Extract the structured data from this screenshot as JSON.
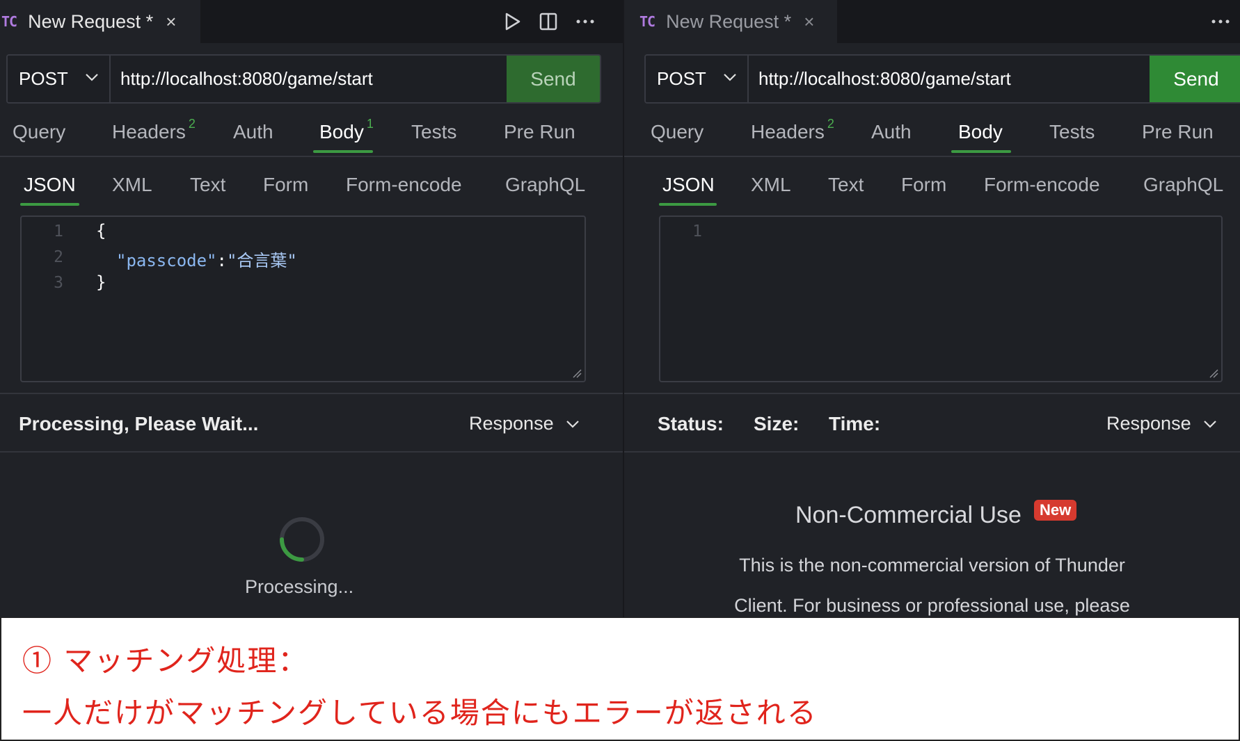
{
  "left": {
    "tab": {
      "logo": "TC",
      "title": "New Request *",
      "close": "×"
    },
    "tab_icons": [
      "play-icon",
      "split-icon",
      "more-icon"
    ],
    "method": "POST",
    "url": "http://localhost:8080/game/start",
    "send": "Send",
    "send_color": "#2e6b2f",
    "sections": {
      "query": "Query",
      "headers": "Headers",
      "headers_count": "2",
      "auth": "Auth",
      "body": "Body",
      "body_count": "1",
      "tests": "Tests",
      "prerun": "Pre Run"
    },
    "body_types": [
      "JSON",
      "XML",
      "Text",
      "Form",
      "Form-encode",
      "GraphQL"
    ],
    "editor": {
      "line_numbers": [
        "1",
        "2",
        "3"
      ],
      "line1": "{",
      "key": "\"passcode\"",
      "colon": ":",
      "value": "\"合言葉\"",
      "line3": "}"
    },
    "status_text": "Processing, Please Wait...",
    "response_label": "Response",
    "processing": "Processing..."
  },
  "right": {
    "tab": {
      "logo": "TC",
      "title": "New Request *",
      "close": "×"
    },
    "method": "POST",
    "url": "http://localhost:8080/game/start",
    "send": "Send",
    "send_color": "#2f8a35",
    "sections": {
      "query": "Query",
      "headers": "Headers",
      "headers_count": "2",
      "auth": "Auth",
      "body": "Body",
      "tests": "Tests",
      "prerun": "Pre Run"
    },
    "body_types": [
      "JSON",
      "XML",
      "Text",
      "Form",
      "Form-encode",
      "GraphQL"
    ],
    "editor": {
      "line_numbers": [
        "1"
      ]
    },
    "status": {
      "status": "Status:",
      "size": "Size:",
      "time": "Time:"
    },
    "response_label": "Response",
    "notice": {
      "title": "Non-Commercial Use",
      "badge": "New",
      "line1": "This is the non-commercial version of Thunder",
      "line2": "Client. For business or professional use, please"
    }
  },
  "caption": {
    "line1": "① マッチング処理：",
    "line2": "一人だけがマッチングしている場合にもエラーが返される"
  },
  "colors": {
    "accent_green": "#3c9a42",
    "badge_red": "#d63a2f",
    "caption_red": "#e0241c"
  }
}
